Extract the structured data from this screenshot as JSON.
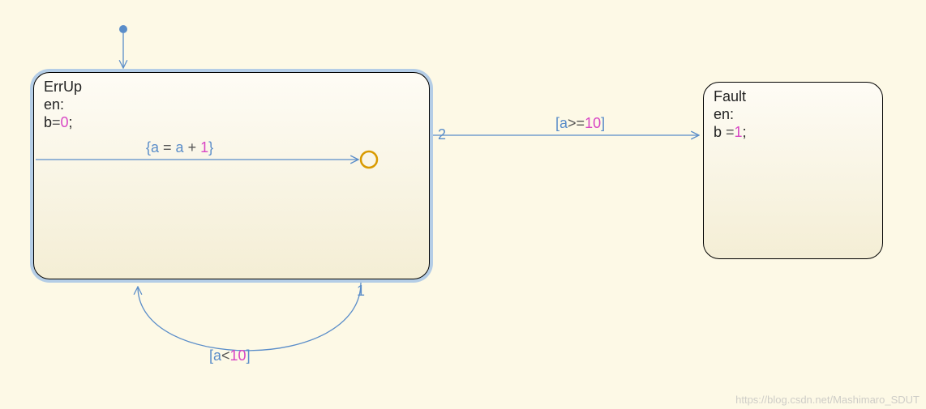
{
  "states": {
    "errup": {
      "name": "ErrUp",
      "entry_action_key": "en:",
      "entry_action_var": "b",
      "entry_action_eq": "=",
      "entry_action_val": "0",
      "entry_action_end": ";"
    },
    "fault": {
      "name": "Fault",
      "entry_action_key": "en:",
      "entry_action_prefix": "b ",
      "entry_action_eq": "=",
      "entry_action_val": "1",
      "entry_action_end": ";"
    }
  },
  "transitions": {
    "internal_action": {
      "open": "{",
      "lhs": "a ",
      "eq": "= ",
      "rhs": "a ",
      "plus": "+ ",
      "val": "1",
      "close": "}"
    },
    "self": {
      "open": "[",
      "var": "a",
      "op": "<",
      "val": "10",
      "close": "]"
    },
    "to_fault": {
      "open": "[",
      "var": "a",
      "op": ">=",
      "val": "10",
      "close": "]"
    },
    "priority_self": "1",
    "priority_tofault": "2"
  },
  "watermark": "https://blog.csdn.net/Mashimaro_SDUT"
}
